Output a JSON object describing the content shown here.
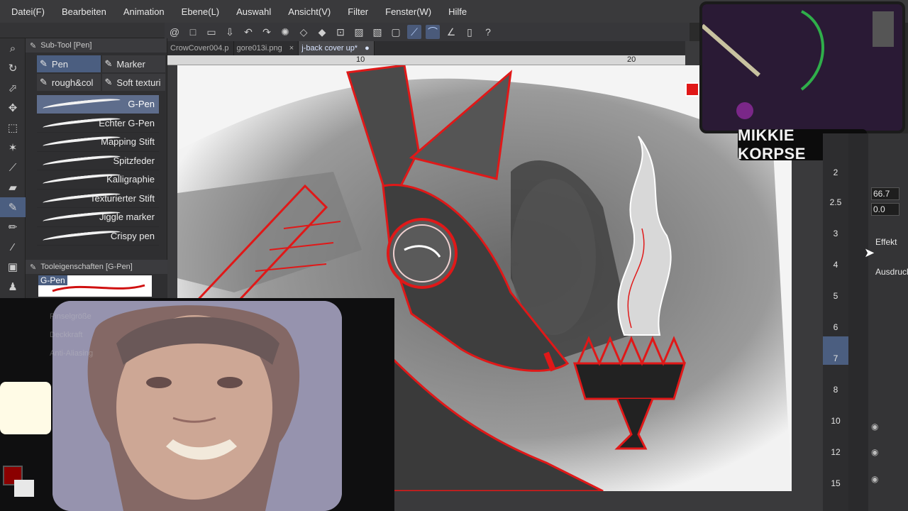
{
  "menu": [
    "Datei(F)",
    "Bearbeiten",
    "Animation",
    "Ebene(L)",
    "Auswahl",
    "Ansicht(V)",
    "Filter",
    "Fenster(W)",
    "Hilfe"
  ],
  "subtool": {
    "title": "Sub-Tool [Pen]",
    "tabs": [
      "Pen",
      "Marker",
      "rough&col",
      "Soft texturi"
    ],
    "brushes": [
      "G-Pen",
      "Echter G-Pen",
      "Mapping Stift",
      "Spitzfeder",
      "Kalligraphie",
      "Texturierter Stift",
      "Jiggle marker",
      "Crispy pen"
    ]
  },
  "toolprops": {
    "title": "Tooleigenschaften [G-Pen]",
    "name": "G-Pen"
  },
  "doctabs": [
    "CrowCover004.p",
    "gore013i.png",
    "j-back cover up*"
  ],
  "ruler": {
    "marks": [
      "10",
      "20"
    ]
  },
  "photo_labels": [
    "Pinselgröße",
    "Deckkraft",
    "Anti-Aliasing"
  ],
  "stream": {
    "name": "MIKKIE KORPSE"
  },
  "brushsizes": [
    "2",
    "2.5",
    "3",
    "4",
    "5",
    "6",
    "7",
    "8",
    "10",
    "12",
    "15"
  ],
  "right": {
    "val1": "66.7",
    "val2": "0.0",
    "effekt": "Effekt",
    "ausdruck": "Ausdruck"
  },
  "colors": {
    "accent": "#4b5e80",
    "line_red": "#e01818",
    "main_color": "#8b0000"
  }
}
